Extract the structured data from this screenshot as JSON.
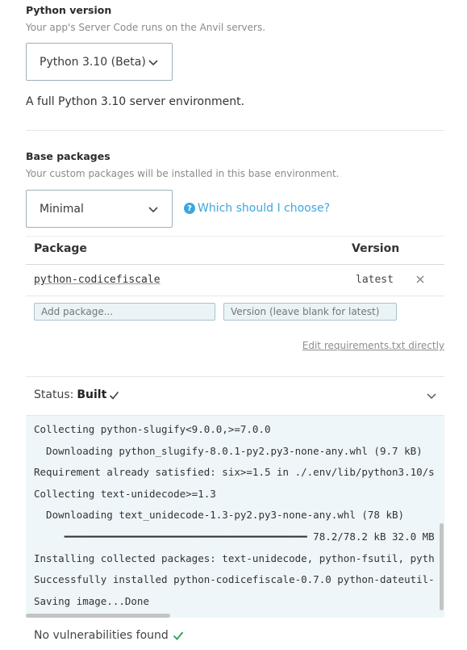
{
  "python_version": {
    "title": "Python version",
    "subtitle": "Your app's Server Code runs on the Anvil servers.",
    "selected": "Python 3.10 (Beta)",
    "description": "A full Python 3.10 server environment."
  },
  "base_packages": {
    "title": "Base packages",
    "subtitle": "Your custom packages will be installed in this base environment.",
    "selected": "Minimal",
    "help_link": "Which should I choose?",
    "help_icon": "question-icon"
  },
  "packages_table": {
    "col_package": "Package",
    "col_version": "Version",
    "rows": [
      {
        "name": "python-codicefiscale",
        "version": "latest"
      }
    ],
    "add_package_placeholder": "Add package...",
    "add_version_placeholder": "Version (leave blank for latest)",
    "edit_link": "Edit requirements.txt directly"
  },
  "status": {
    "label": "Status:",
    "value": "Built",
    "log": [
      "Collecting python-slugify<9.0.0,>=7.0.0",
      "  Downloading python_slugify-8.0.1-py2.py3-none-any.whl (9.7 kB)",
      "Requirement already satisfied: six>=1.5 in ./.env/lib/python3.10/s",
      "Collecting text-unidecode>=1.3",
      "  Downloading text_unidecode-1.3-py2.py3-none-any.whl (78 kB)",
      "     ━━━━━━━━━━━━━━━━━━━━━━━━━━━━━━━━━━━━━━━━ 78.2/78.2 kB 32.0 MB",
      "Installing collected packages: text-unidecode, python-fsutil, pyth",
      "Successfully installed python-codicefiscale-0.7.0 python-dateutil-",
      "Saving image...Done"
    ]
  },
  "vulnerabilities": "No vulnerabilities found",
  "colors": {
    "accent": "#3ea6dc",
    "success": "#2e9e4f"
  }
}
